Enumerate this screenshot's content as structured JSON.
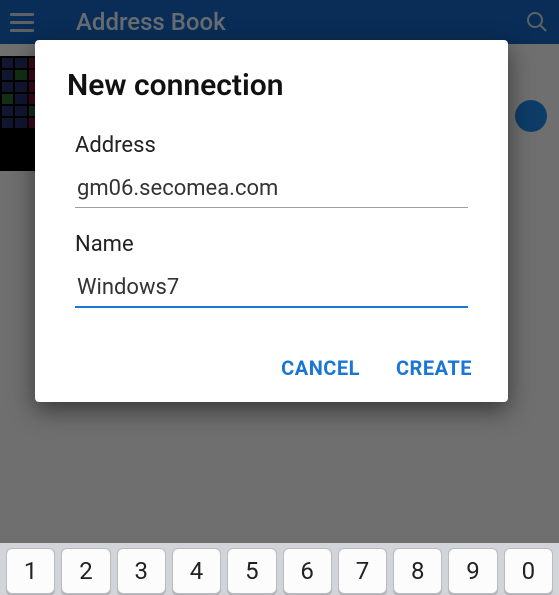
{
  "appbar": {
    "title": "Address Book"
  },
  "dialog": {
    "title": "New connection",
    "address_label": "Address",
    "address_value": "gm06.secomea.com",
    "name_label": "Name",
    "name_value": "Windows7",
    "cancel_label": "CANCEL",
    "create_label": "CREATE"
  },
  "keyboard": {
    "keys": [
      "1",
      "2",
      "3",
      "4",
      "5",
      "6",
      "7",
      "8",
      "9",
      "0"
    ]
  }
}
